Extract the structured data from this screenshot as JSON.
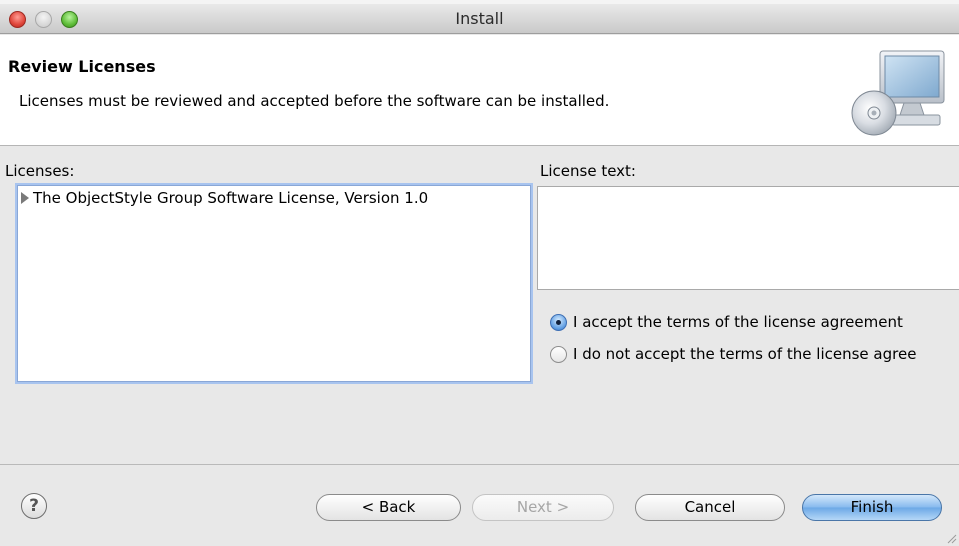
{
  "window": {
    "title": "Install"
  },
  "header": {
    "title": "Review Licenses",
    "description": "Licenses must be reviewed and accepted before the software can be installed."
  },
  "licenses": {
    "label": "Licenses:",
    "items": [
      {
        "label": "The ObjectStyle Group Software License, Version 1.0"
      }
    ]
  },
  "license_text": {
    "label": "License text:",
    "content": ""
  },
  "agreement": {
    "accept_label": "I accept the terms of the license agreement",
    "decline_label": "I do not accept the terms of the license agree",
    "selected": "accept"
  },
  "footer": {
    "help_label": "?",
    "back_label": "< Back",
    "next_label": "Next >",
    "cancel_label": "Cancel",
    "finish_label": "Finish"
  }
}
